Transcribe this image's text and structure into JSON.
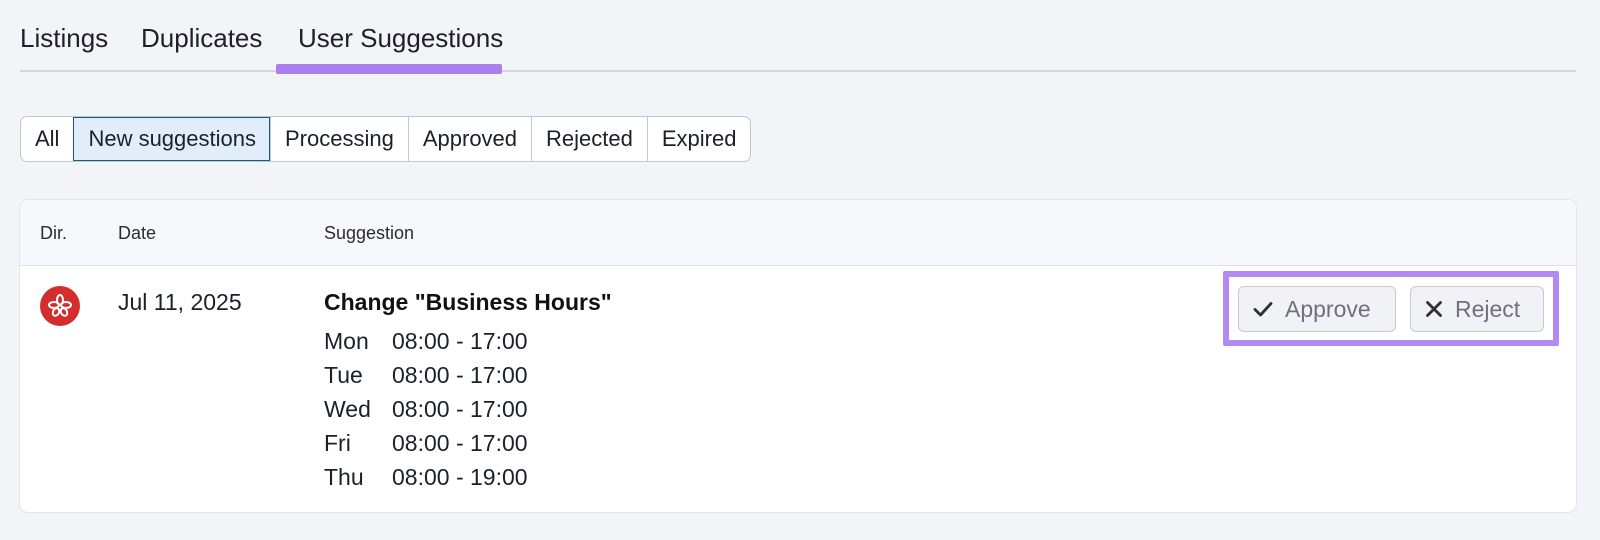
{
  "tabs": [
    {
      "label": "Listings"
    },
    {
      "label": "Duplicates"
    },
    {
      "label": "User Suggestions",
      "active": true
    }
  ],
  "filters": [
    {
      "label": "All"
    },
    {
      "label": "New suggestions",
      "active": true
    },
    {
      "label": "Processing"
    },
    {
      "label": "Approved"
    },
    {
      "label": "Rejected"
    },
    {
      "label": "Expired"
    }
  ],
  "table": {
    "columns": {
      "dir": "Dir.",
      "date": "Date",
      "suggestion": "Suggestion"
    },
    "row": {
      "directory_icon": "yelp-icon",
      "date": "Jul 11, 2025",
      "suggestion_title": "Change \"Business Hours\"",
      "hours": [
        {
          "day": "Mon",
          "time": "08:00 - 17:00"
        },
        {
          "day": "Tue",
          "time": "08:00 - 17:00"
        },
        {
          "day": "Wed",
          "time": "08:00 - 17:00"
        },
        {
          "day": "Fri",
          "time": "08:00 - 17:00"
        },
        {
          "day": "Thu",
          "time": "08:00 - 19:00"
        }
      ],
      "actions": {
        "approve_label": "Approve",
        "reject_label": "Reject"
      }
    }
  },
  "colors": {
    "tab_underline": "#a97ff0",
    "highlight_frame": "#b28af1",
    "directory_icon_bg": "#d32d2d",
    "active_filter_bg": "#e2edfb",
    "active_filter_border": "#0f5f7a"
  }
}
